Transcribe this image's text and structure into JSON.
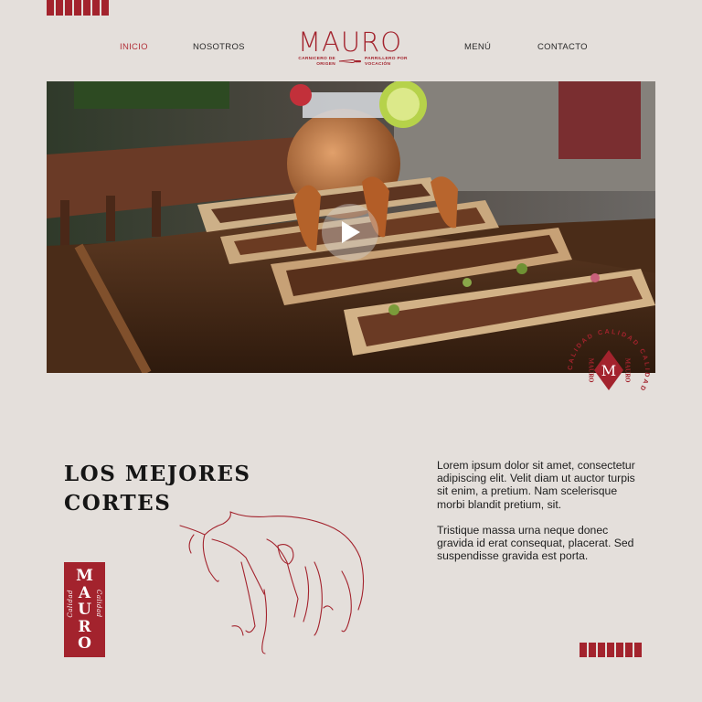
{
  "nav": {
    "items": [
      {
        "label": "INICIO",
        "active": true
      },
      {
        "label": "NOSOTROS",
        "active": false
      },
      {
        "label": "MENÚ",
        "active": false
      },
      {
        "label": "CONTACTO",
        "active": false
      }
    ]
  },
  "brand": {
    "name": "MAURO",
    "tagline_left": "CARNICERO DE ORIGEN",
    "tagline_right": "PARRILLERO POR VOCACIÓN"
  },
  "hero": {
    "media": "grilled-bone-marrow-platter-video",
    "play_icon": "play-icon"
  },
  "badge": {
    "ring_text": "CALIDAD CALIDAD CALIDAD",
    "side_text": "MAURO",
    "center_letter": "M"
  },
  "section": {
    "heading_line1": "LOS MEJORES",
    "heading_line2": "CORTES",
    "paragraph1": "Lorem ipsum dolor sit amet, consectetur adipiscing elit. Velit diam ut auctor turpis sit enim, a pretium. Nam scelerisque morbi blandit pretium, sit.",
    "paragraph2": "Tristique massa urna neque donec gravida id erat consequat, placerat. Sed suspendisse gravida est porta."
  },
  "logo_box": {
    "letters": [
      "M",
      "A",
      "U",
      "R",
      "O"
    ],
    "side_left": "Calidad",
    "side_right": "Calidad"
  },
  "decor": {
    "illustration": "bull-line-drawing",
    "stripe_count_top": 7,
    "stripe_count_bottom": 7
  },
  "colors": {
    "accent": "#a3232d",
    "background": "#e4dfdb",
    "text": "#1c1c1c"
  }
}
